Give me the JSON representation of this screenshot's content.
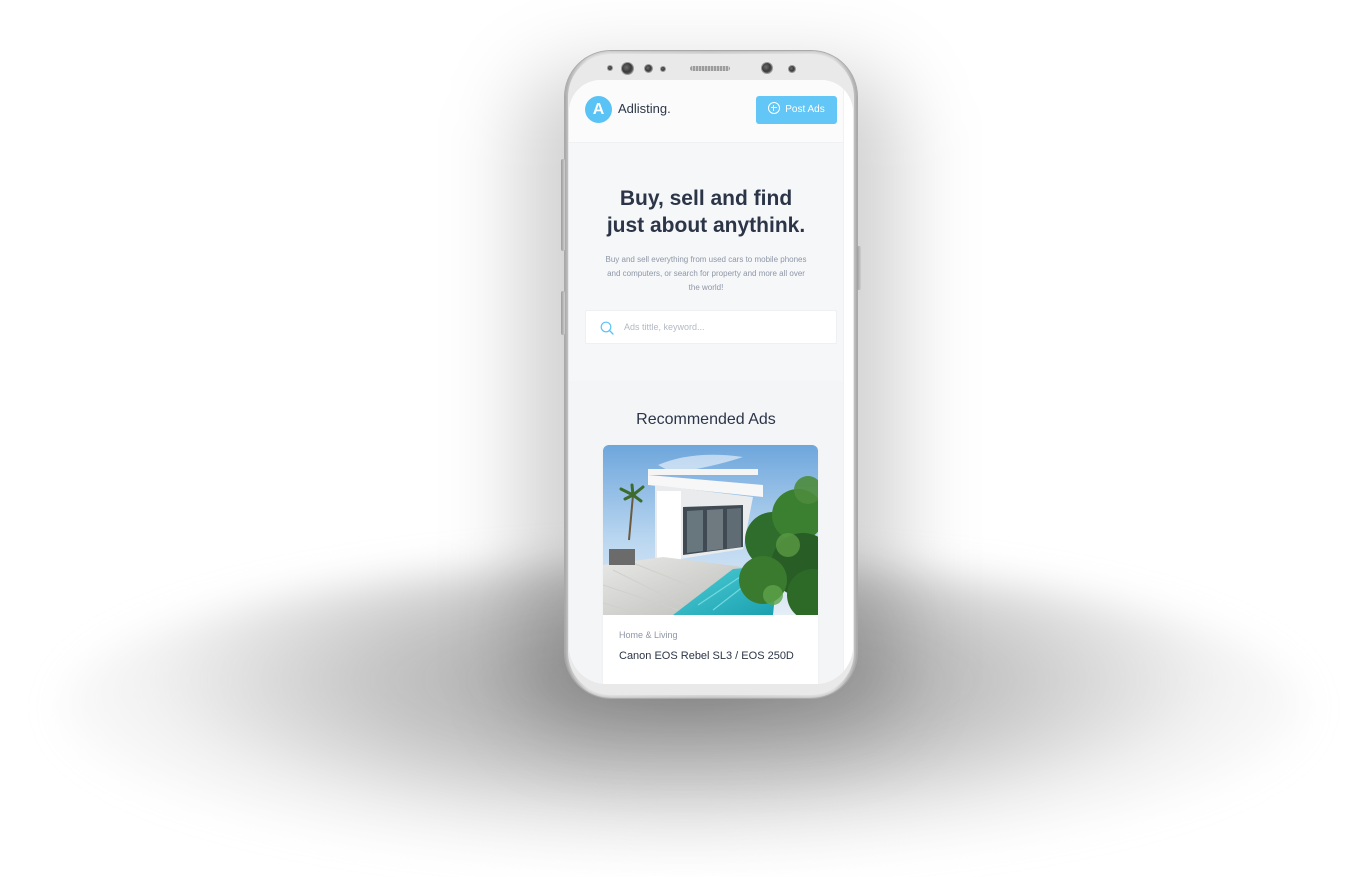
{
  "app": {
    "logo_letter": "A",
    "logo_text": "Adlisting.",
    "post_ads_label": "Post Ads"
  },
  "hero": {
    "title_line1": "Buy, sell and find",
    "title_line2": "just about anythink.",
    "subtitle": "Buy and sell everything from used cars to mobile phones and computers, or search for property and more all over the world!"
  },
  "search": {
    "placeholder": "Ads tittle, keyword..."
  },
  "recommended": {
    "title": "Recommended Ads",
    "cards": [
      {
        "category": "Home & Living",
        "title": "Canon EOS Rebel SL3 / EOS 250D"
      }
    ]
  },
  "colors": {
    "accent": "#5ac3f6",
    "heading": "#2c3547",
    "muted": "#8e96a6"
  },
  "icons": {
    "post_ads": "plus-circle-icon",
    "search": "search-icon"
  }
}
